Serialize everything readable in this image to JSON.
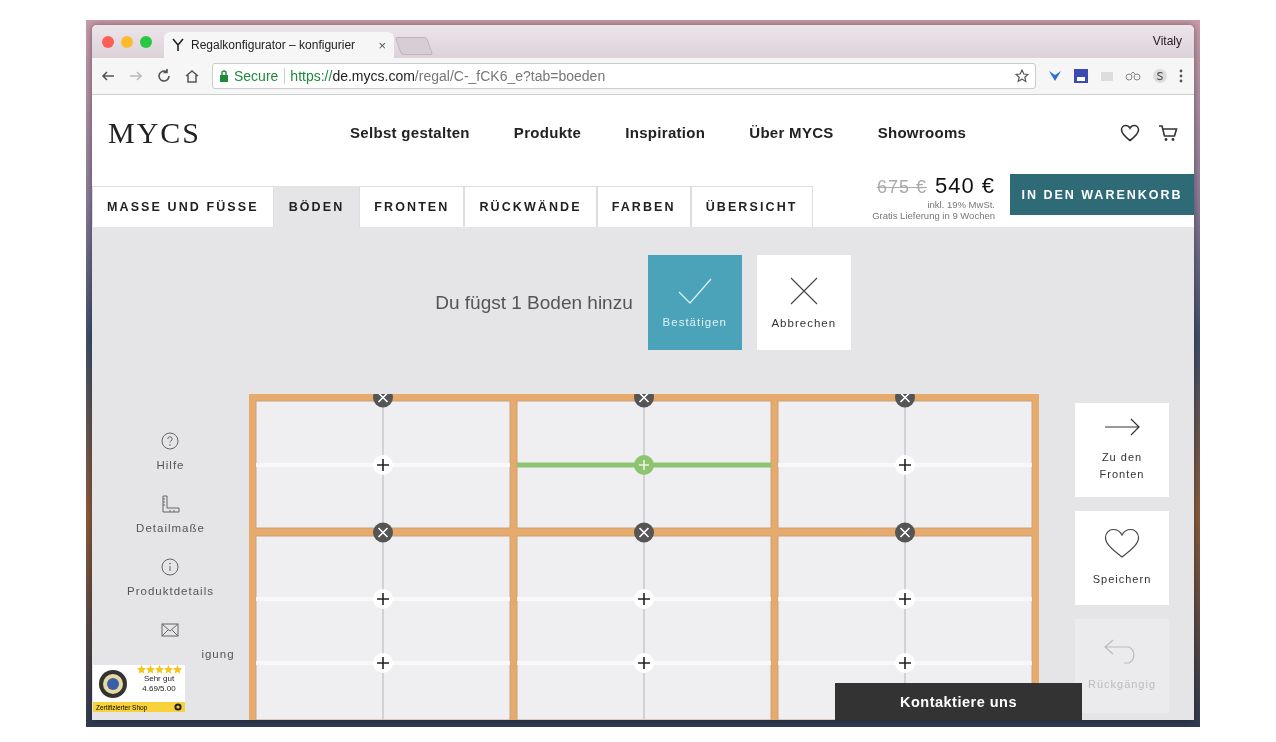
{
  "browser": {
    "tab": {
      "title": "Regalkonfigurator – konfigurier",
      "close": "×"
    },
    "user": "Vitaly",
    "address": {
      "secure_label": "Secure",
      "scheme": "https://",
      "host": "de.mycs.com",
      "path": "/regal/C-_fCK6_e?tab=boeden"
    }
  },
  "header": {
    "logo": "MYCS",
    "nav": [
      "Selbst gestalten",
      "Produkte",
      "Inspiration",
      "Über MYCS",
      "Showrooms"
    ]
  },
  "steps": [
    {
      "label": "MASSE UND FÜSSE",
      "selected": false
    },
    {
      "label": "BÖDEN",
      "selected": true
    },
    {
      "label": "FRONTEN",
      "selected": false
    },
    {
      "label": "RÜCKWÄNDE",
      "selected": false
    },
    {
      "label": "FARBEN",
      "selected": false
    },
    {
      "label": "ÜBERSICHT",
      "selected": false
    }
  ],
  "price": {
    "old": "675 €",
    "current": "540 €",
    "tax_note": "inkl. 19% MwSt.",
    "delivery": "Gratis Lieferung in 9 Wochen"
  },
  "cart_button": "IN DEN WARENKORB",
  "confirm": {
    "message": "Du fügst 1 Boden hinzu",
    "confirm_button": "Bestätigen",
    "cancel_button": "Abbrechen"
  },
  "sidebar": [
    {
      "label": "Hilfe",
      "kind": "help",
      "covered": false
    },
    {
      "label": "Detailmaße",
      "kind": "measure",
      "covered": false
    },
    {
      "label": "Produktdetails",
      "kind": "info",
      "covered": false
    },
    {
      "label": "igung",
      "kind": "mail",
      "covered": true
    }
  ],
  "actions": [
    {
      "label": "Zu den Fronten",
      "kind": "next",
      "disabled": false
    },
    {
      "label": "Speichern",
      "kind": "save",
      "disabled": false
    },
    {
      "label": "Rückgängig",
      "kind": "undo",
      "disabled": true
    }
  ],
  "shelf": {
    "rows": [
      {
        "cells": [
          {
            "slots": [
              {
                "preview": false
              }
            ]
          },
          {
            "slots": [
              {
                "preview": true
              }
            ]
          },
          {
            "slots": [
              {
                "preview": false
              }
            ]
          }
        ]
      },
      {
        "cells": [
          {
            "slots": [
              {
                "preview": false
              },
              {
                "preview": false
              }
            ]
          },
          {
            "slots": [
              {
                "preview": false
              },
              {
                "preview": false
              }
            ]
          },
          {
            "slots": [
              {
                "preview": false
              },
              {
                "preview": false
              }
            ]
          }
        ]
      }
    ]
  },
  "contact_button": "Kontaktiere uns",
  "rating_badge": {
    "stars": 5,
    "verdict": "Sehr gut",
    "score": "4.69/5.00",
    "footer": "Zertifizierter Shop"
  }
}
